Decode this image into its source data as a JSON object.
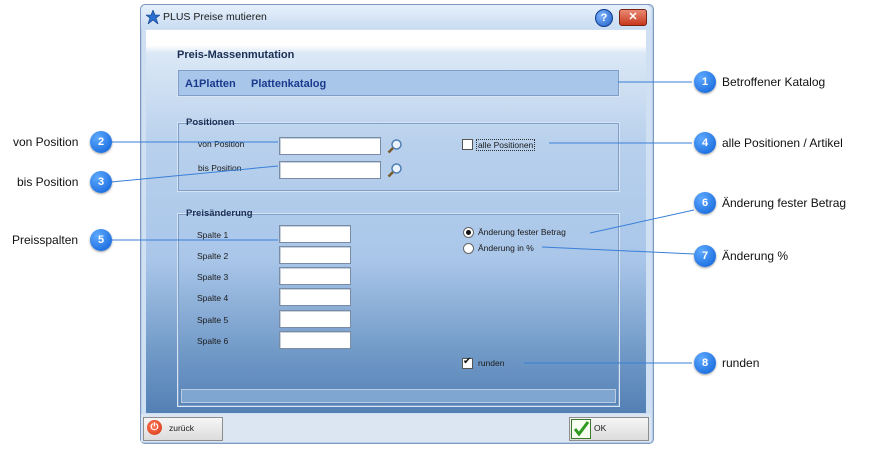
{
  "window": {
    "title": "PLUS Preise mutieren",
    "help_label": "?",
    "close_label": "✕"
  },
  "header": {
    "heading": "Preis-Massenmutation",
    "catalog_code": "A1Platten",
    "catalog_name": "Plattenkatalog"
  },
  "positionen": {
    "group_title": "Positionen",
    "von_label": "von Position",
    "von_value": "",
    "bis_label": "bis Position",
    "bis_value": "",
    "alle_label": "alle Positionen",
    "alle_checked": false
  },
  "preisaenderung": {
    "group_title": "Preisänderung",
    "spalten": [
      {
        "label": "Spalte 1",
        "value": ""
      },
      {
        "label": "Spalte 2",
        "value": ""
      },
      {
        "label": "Spalte 3",
        "value": ""
      },
      {
        "label": "Spalte 4",
        "value": ""
      },
      {
        "label": "Spalte 5",
        "value": ""
      },
      {
        "label": "Spalte 6",
        "value": ""
      }
    ],
    "radio_fix_label": "Änderung fester Betrag",
    "radio_percent_label": "Änderung in %",
    "selected_mode": "Änderung fester Betrag",
    "runden_label": "runden",
    "runden_checked": true
  },
  "buttons": {
    "back_label": "zurück",
    "ok_label": "OK"
  },
  "callouts": [
    {
      "number": "1",
      "text": "Betroffener Katalog"
    },
    {
      "number": "2",
      "text": "von Position"
    },
    {
      "number": "3",
      "text": "bis Position"
    },
    {
      "number": "4",
      "text": "alle Positionen / Artikel"
    },
    {
      "number": "5",
      "text": "Preisspalten"
    },
    {
      "number": "6",
      "text": "Änderung fester Betrag"
    },
    {
      "number": "7",
      "text": "Änderung %"
    },
    {
      "number": "8",
      "text": "runden"
    }
  ],
  "colors": {
    "callout": "#0b5fd6",
    "accent_text": "#1a3a8c",
    "panel": "#a9c6e9"
  }
}
